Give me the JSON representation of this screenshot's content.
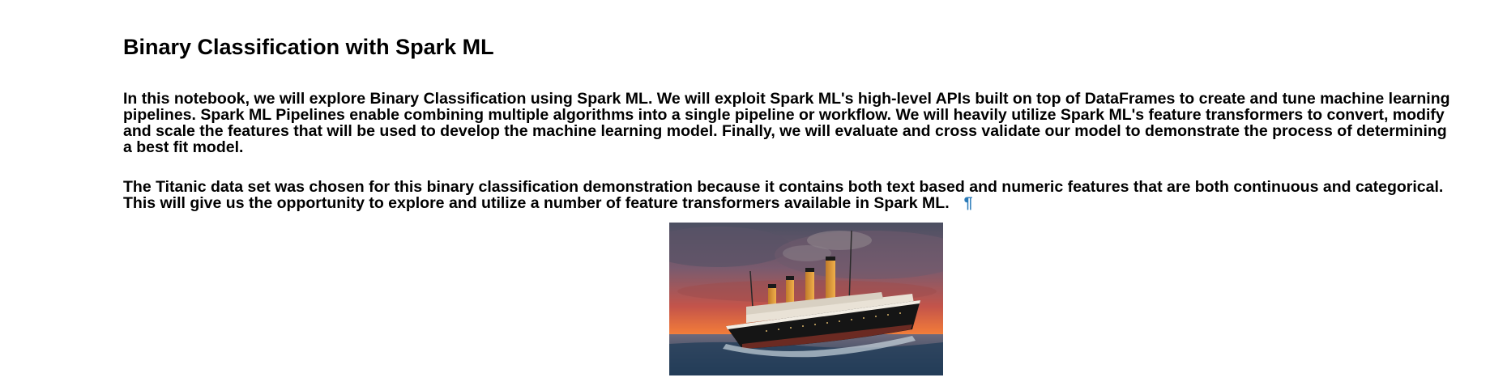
{
  "notebook": {
    "title": "Binary Classification with Spark ML",
    "intro": "In this notebook, we will explore Binary Classification using Spark ML. We will exploit Spark ML's high-level APIs built on top of DataFrames to create and tune machine learning pipelines. Spark ML Pipelines enable combining multiple algorithms into a single pipeline or workflow. We will heavily utilize Spark ML's feature transformers to convert, modify and scale the features that will be used to develop the machine learning model. Finally, we will evaluate and cross validate our model to demonstrate the process of determining a best fit model.",
    "dataset_text": "The Titanic data set was chosen for this binary classification demonstration because it contains both text based and numeric features that are both continuous and categorical. This will give us the opportunity to explore and utilize a number of feature transformers available in Spark ML.",
    "anchor_link": "¶"
  },
  "colors": {
    "link": "#2a7ab8"
  },
  "image": {
    "subject": "titanic-ship-at-sunset"
  }
}
